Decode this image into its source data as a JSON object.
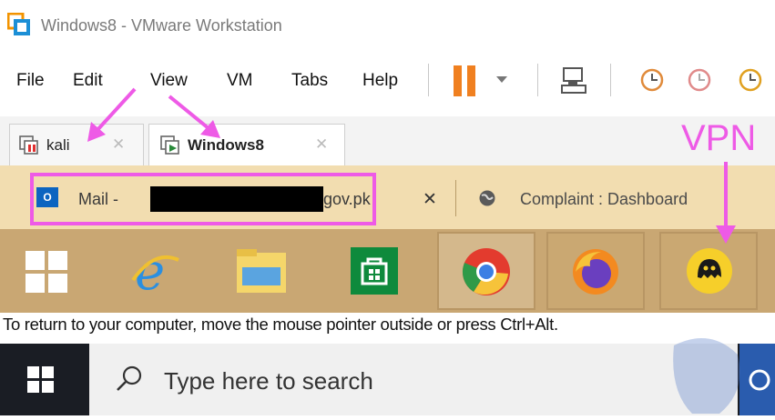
{
  "window": {
    "title": "Windows8 - VMware Workstation"
  },
  "menu": [
    "File",
    "Edit",
    "View",
    "VM",
    "Tabs",
    "Help"
  ],
  "vm_tabs": [
    {
      "label": "kali",
      "active": false
    },
    {
      "label": "Windows8",
      "active": true
    }
  ],
  "browser_tabs": [
    {
      "label_prefix": "Mail - ",
      "label_suffix": "gov.pk"
    },
    {
      "label": "Complaint : Dashboard"
    }
  ],
  "annotation": {
    "vpn_label": "VPN",
    "color": "#ee5ae6"
  },
  "message": "To return to your computer, move the mouse pointer outside or press Ctrl+Alt.",
  "search": {
    "placeholder": "Type here to search"
  },
  "taskbar_icons": [
    "windows-start",
    "internet-explorer",
    "file-explorer",
    "store",
    "chrome",
    "firefox",
    "cyberghost-vpn"
  ]
}
